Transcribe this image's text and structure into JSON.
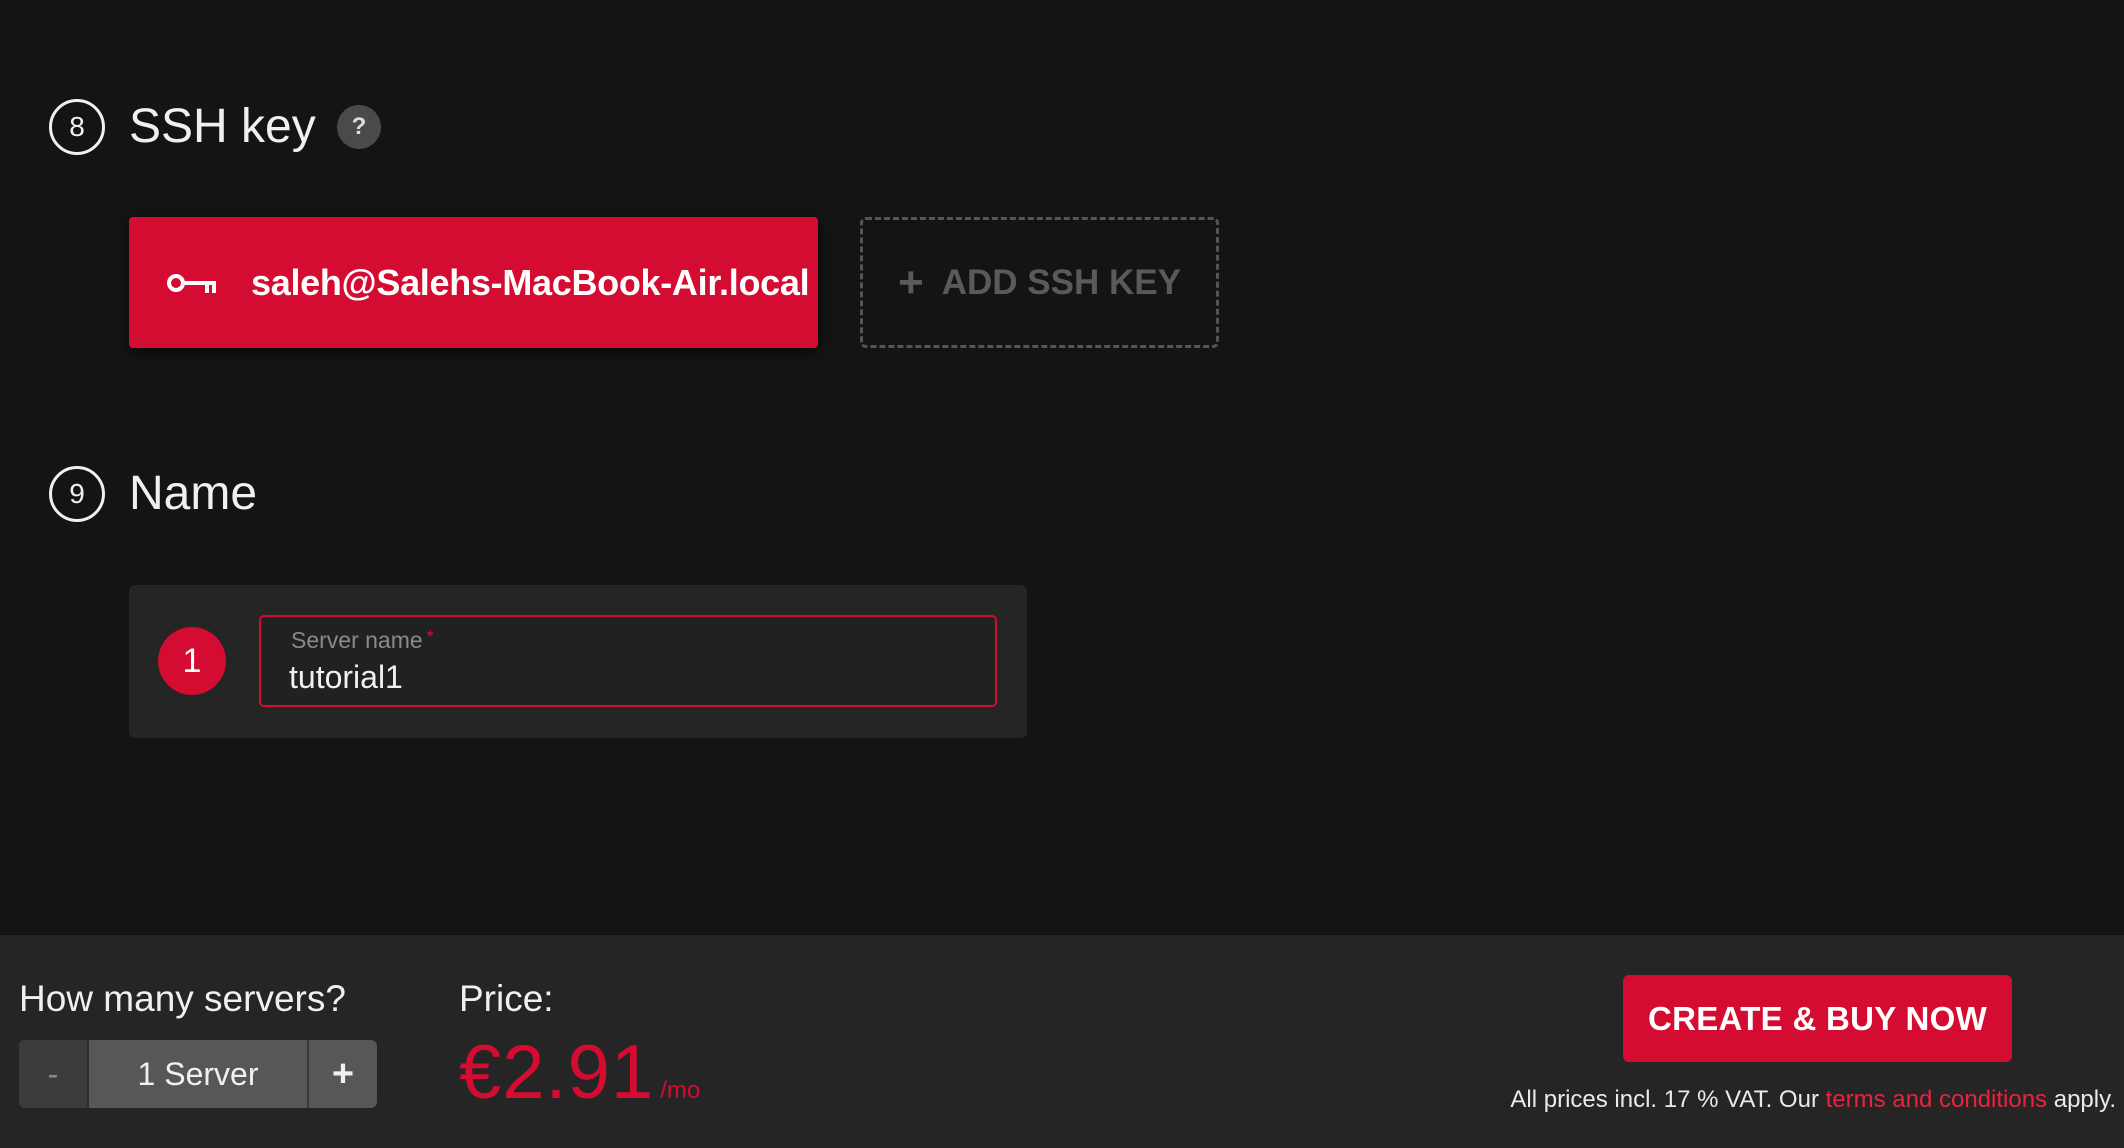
{
  "sections": {
    "ssh": {
      "number": "8",
      "title": "SSH key",
      "help": "?"
    },
    "name": {
      "number": "9",
      "title": "Name"
    }
  },
  "ssh_keys": {
    "selected_key": "saleh@Salehs-MacBook-Air.local",
    "add_label": "ADD SSH KEY",
    "add_icon": "+"
  },
  "server_name": {
    "index": "1",
    "label": "Server name",
    "required_mark": "*",
    "value": "tutorial1"
  },
  "footer": {
    "count_label": "How many servers?",
    "minus": "-",
    "count_value": "1 Server",
    "plus": "+",
    "price_label": "Price:",
    "price": "€2.91",
    "price_period": "/mo",
    "cta": "CREATE & BUY NOW",
    "note_prefix": "All prices incl. 17 % VAT. Our ",
    "note_link": "terms and conditions",
    "note_suffix": " apply."
  },
  "colors": {
    "accent": "#d50c31",
    "background": "#141414",
    "footer_bg": "#252525"
  }
}
